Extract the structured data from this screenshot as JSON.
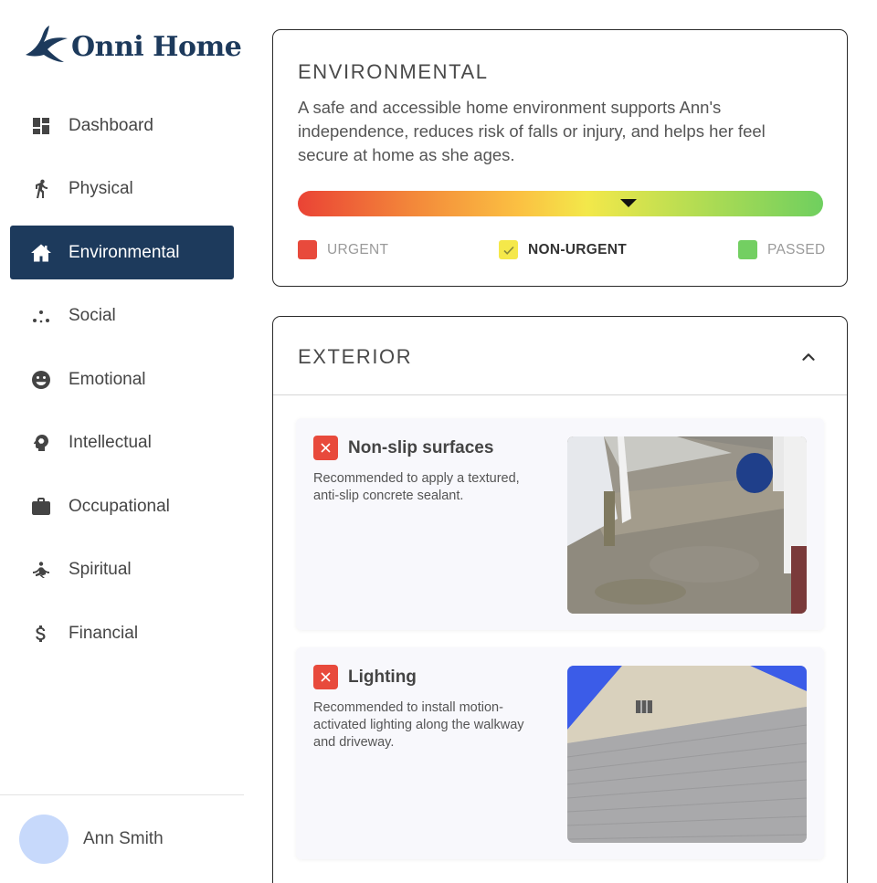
{
  "app": {
    "name": "Onni Home"
  },
  "sidebar": {
    "items": [
      {
        "label": "Dashboard",
        "icon": "dashboard-icon"
      },
      {
        "label": "Physical",
        "icon": "walking-icon"
      },
      {
        "label": "Environmental",
        "icon": "home-icon",
        "active": true
      },
      {
        "label": "Social",
        "icon": "social-dots-icon"
      },
      {
        "label": "Emotional",
        "icon": "smiley-icon"
      },
      {
        "label": "Intellectual",
        "icon": "brain-icon"
      },
      {
        "label": "Occupational",
        "icon": "briefcase-icon"
      },
      {
        "label": "Spiritual",
        "icon": "meditation-icon"
      },
      {
        "label": "Financial",
        "icon": "dollar-icon"
      }
    ]
  },
  "user": {
    "name": "Ann Smith"
  },
  "environmental": {
    "title": "ENVIRONMENTAL",
    "description": "A safe and accessible home environment supports Ann's independence, reduces risk of falls or injury, and helps her feel secure at home as she ages.",
    "scale_level_fraction": 0.63,
    "legend": [
      {
        "label": "URGENT",
        "color": "#e84a3c"
      },
      {
        "label": "NON-URGENT",
        "color": "#f5e84a",
        "current": true
      },
      {
        "label": "PASSED",
        "color": "#73cf62"
      }
    ],
    "colors": {
      "urgent": "#ea4335",
      "non_urgent": "#f3e84a",
      "passed": "#6fcf5f",
      "accent": "#1d3a5c"
    }
  },
  "exterior": {
    "title": "EXTERIOR",
    "items": [
      {
        "title": "Non-slip surfaces",
        "description": "Recommended to apply a textured, anti-slip concrete sealant.",
        "status_icon": "x-icon"
      },
      {
        "title": "Lighting",
        "description": "Recommended to install motion-activated lighting along the walkway and driveway.",
        "status_icon": "x-icon"
      }
    ]
  }
}
